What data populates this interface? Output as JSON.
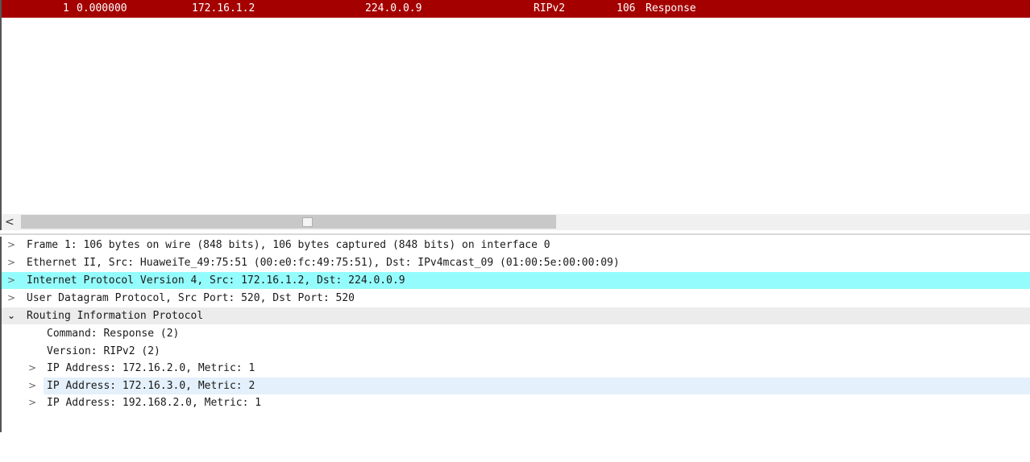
{
  "packet_list": {
    "rows": [
      {
        "no": "1",
        "time": "0.000000",
        "source": "172.16.1.2",
        "destination": "224.0.0.9",
        "protocol": "RIPv2",
        "length": "106",
        "info": "Response"
      }
    ]
  },
  "scrollbar": {
    "left_arrow": "<"
  },
  "details": {
    "tree": [
      {
        "expander": ">",
        "text": "Frame 1: 106 bytes on wire (848 bits), 106 bytes captured (848 bits) on interface 0"
      },
      {
        "expander": ">",
        "text": "Ethernet II, Src: HuaweiTe_49:75:51 (00:e0:fc:49:75:51), Dst: IPv4mcast_09 (01:00:5e:00:00:09)"
      },
      {
        "expander": ">",
        "text": "Internet Protocol Version 4, Src: 172.16.1.2, Dst: 224.0.0.9"
      },
      {
        "expander": ">",
        "text": "User Datagram Protocol, Src Port: 520, Dst Port: 520"
      },
      {
        "expander": "⌄",
        "text": "Routing Information Protocol"
      },
      {
        "expander": "",
        "text": "Command: Response (2)"
      },
      {
        "expander": "",
        "text": "Version: RIPv2 (2)"
      },
      {
        "expander": ">",
        "text": "IP Address: 172.16.2.0, Metric: 1"
      },
      {
        "expander": ">",
        "text": "IP Address: 172.16.3.0, Metric: 2"
      },
      {
        "expander": ">",
        "text": "IP Address: 192.168.2.0, Metric: 1"
      }
    ]
  },
  "colors": {
    "packet_row_bg": "#a40000",
    "selected_tree_row_bg": "#94fcfc",
    "hover_tree_row_bg": "#e4f0fb"
  }
}
